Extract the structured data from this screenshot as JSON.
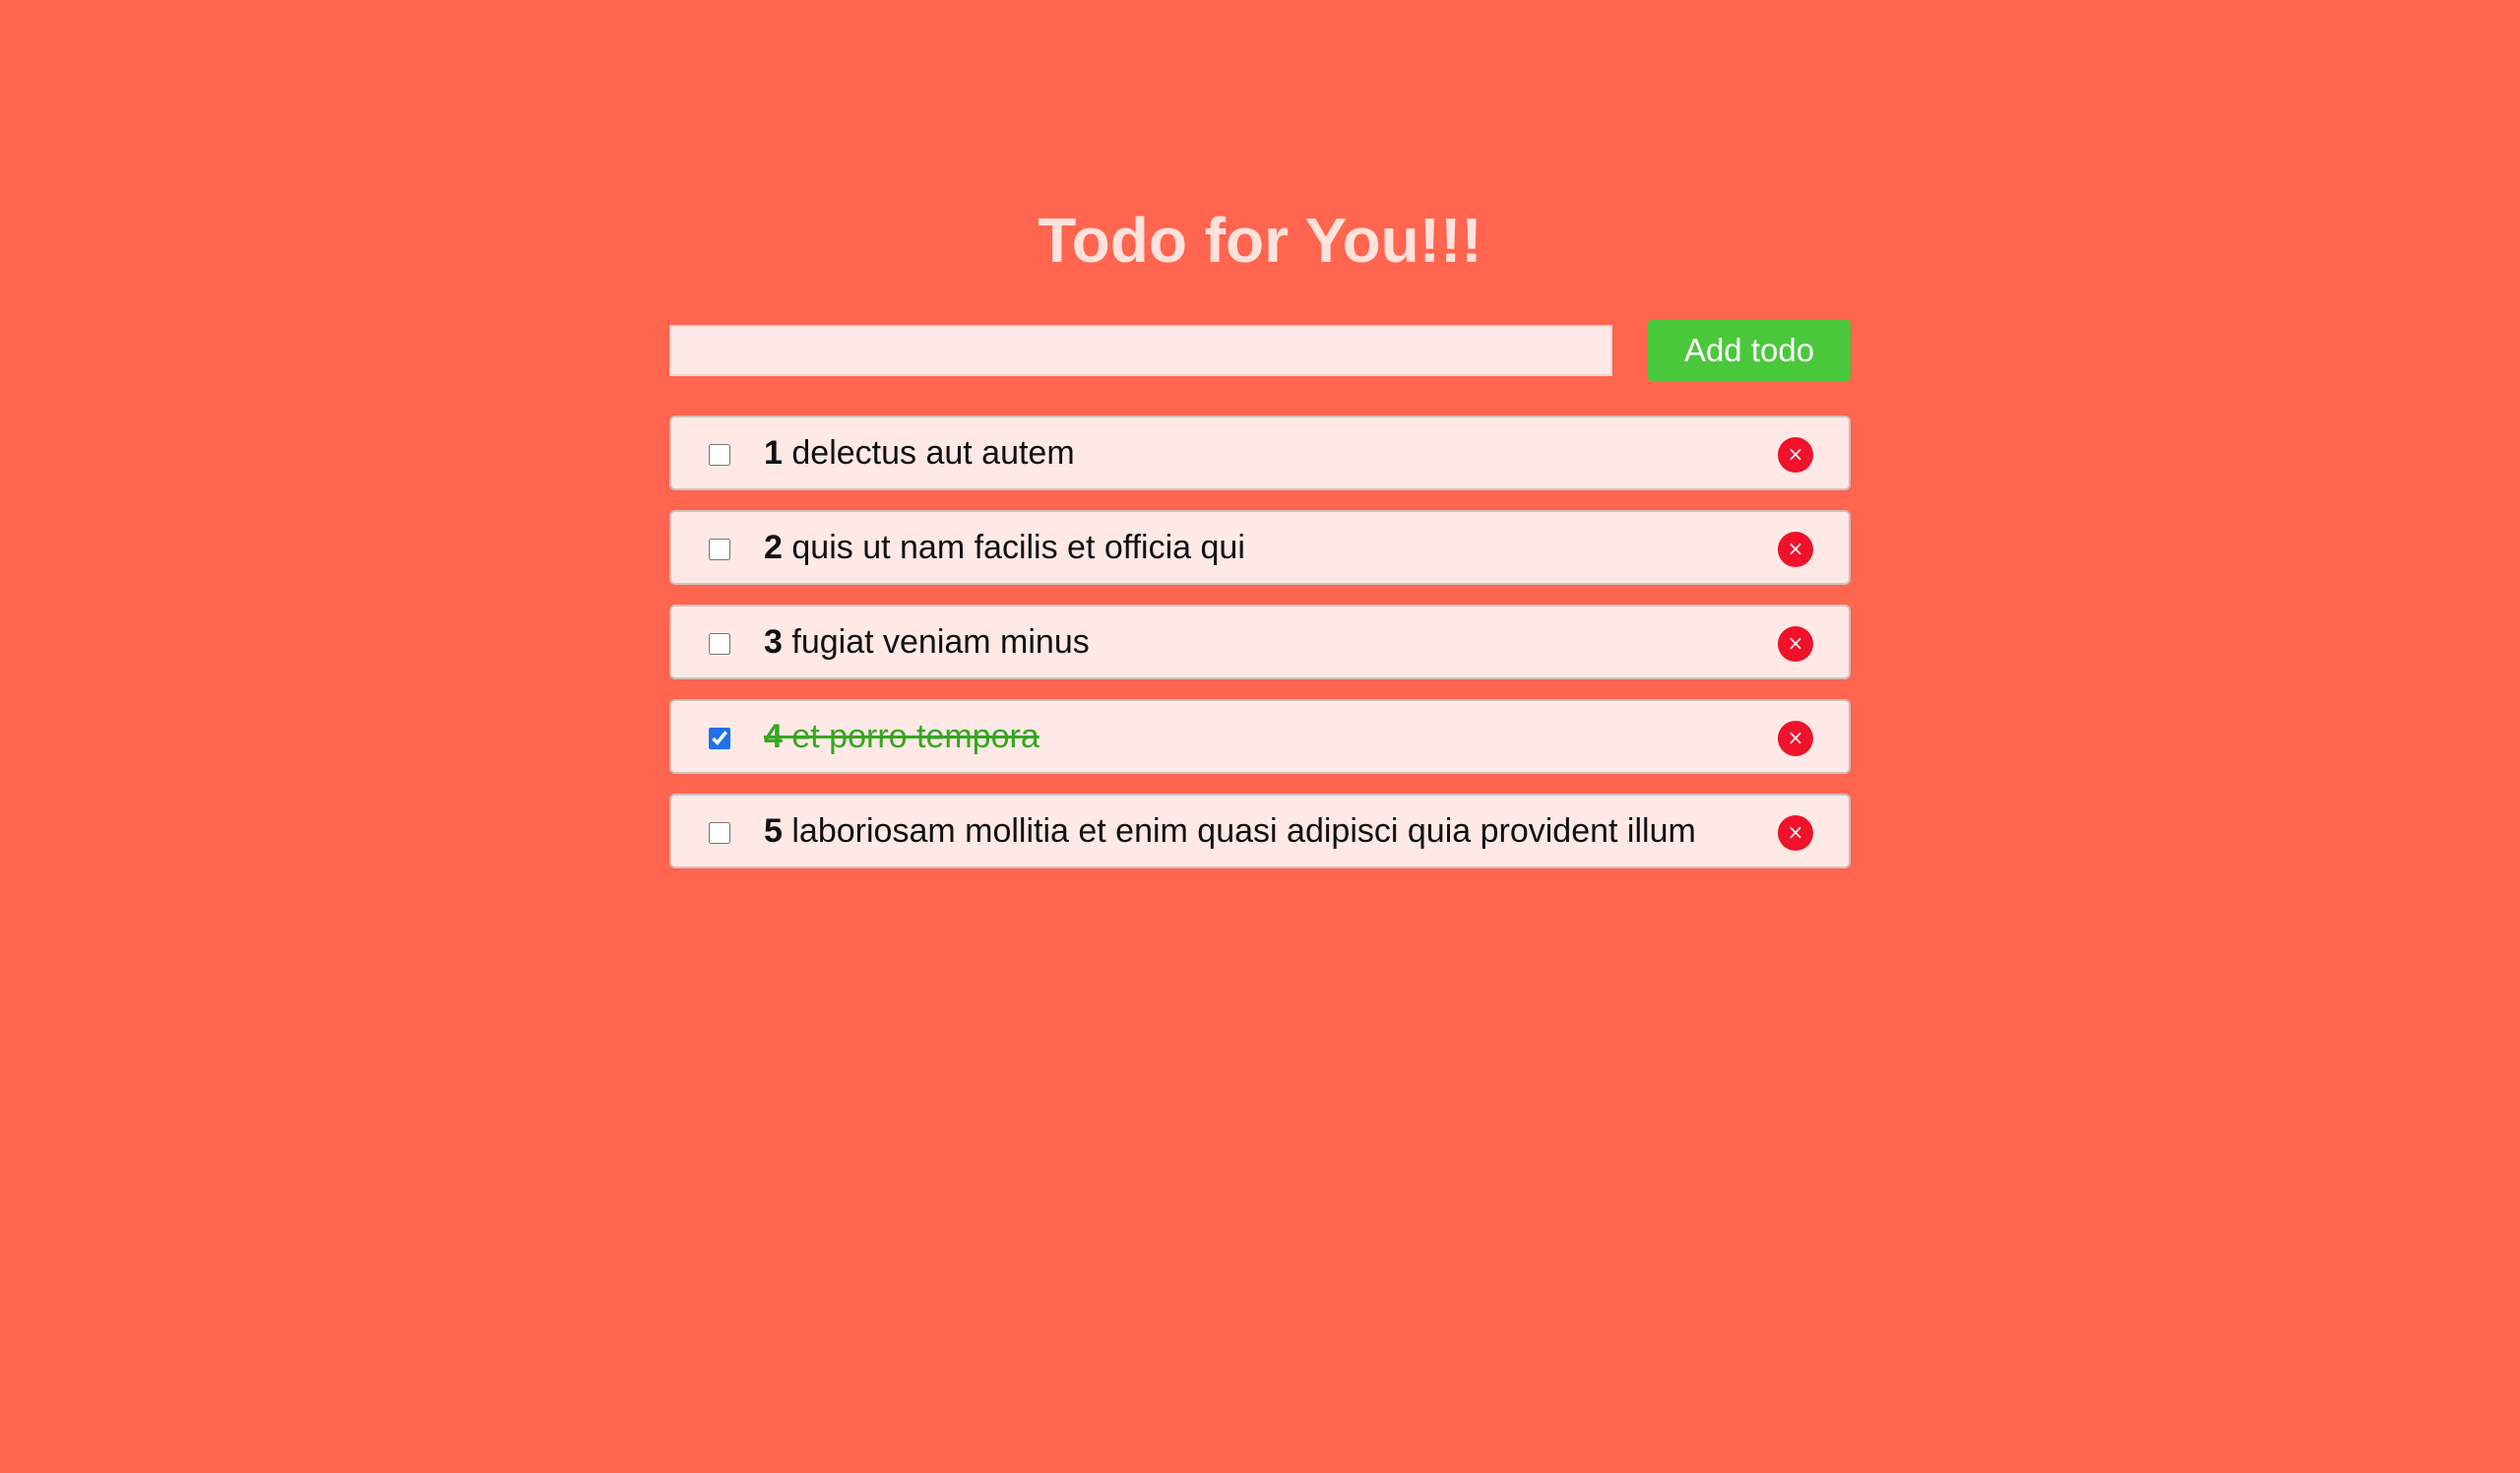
{
  "header": {
    "title": "Todo for You!!!"
  },
  "form": {
    "input_value": "",
    "button_label": "Add todo"
  },
  "todos": [
    {
      "number": "1",
      "text": "delectus aut autem",
      "completed": false
    },
    {
      "number": "2",
      "text": "quis ut nam facilis et officia qui",
      "completed": false
    },
    {
      "number": "3",
      "text": "fugiat veniam minus",
      "completed": false
    },
    {
      "number": "4",
      "text": "et porro tempora",
      "completed": true
    },
    {
      "number": "5",
      "text": "laboriosam mollitia et enim quasi adipisci quia provident illum",
      "completed": false
    }
  ],
  "icons": {
    "delete": "close-icon",
    "delete_glyph": "×"
  },
  "colors": {
    "background": "#ff654f",
    "title": "#ffe2dc",
    "card_background": "#ffe9e6",
    "add_button": "#4ac83b",
    "delete_button": "#f0112a",
    "completed_text": "#36a61f",
    "checkbox_checked": "#1f72e8"
  }
}
